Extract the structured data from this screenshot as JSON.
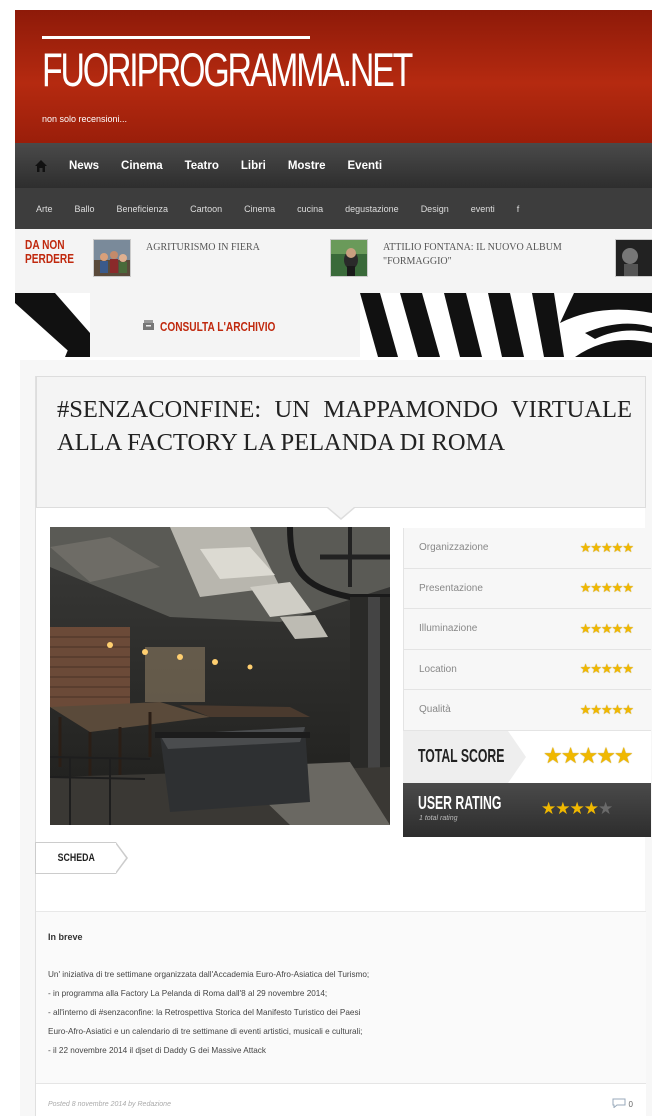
{
  "site": {
    "logo": "FUORIPROGRAMMA.NET",
    "tagline": "non solo recensioni..."
  },
  "main_nav": [
    "News",
    "Cinema",
    "Teatro",
    "Libri",
    "Mostre",
    "Eventi"
  ],
  "category_nav": [
    "Arte",
    "Ballo",
    "Beneficienza",
    "Cartoon",
    "Cinema",
    "cucina",
    "degustazione",
    "Design",
    "eventi",
    "f"
  ],
  "da_non_perdere": {
    "label": "DA NON PERDERE",
    "items": [
      {
        "title": "AGRITURISMO IN FIERA"
      },
      {
        "title": "ATTILIO FONTANA: IL NUOVO ALBUM \"FORMAGGIO\""
      }
    ]
  },
  "archive": {
    "label": "CONSULTA L'ARCHIVIO"
  },
  "article": {
    "title": "#SENZACONFINE: UN MAPPAMONDO VIRTUALE ALLA FACTORY LA PELANDA DI ROMA",
    "review": {
      "criteria": [
        {
          "name": "Organizzazione",
          "stars": 5
        },
        {
          "name": "Presentazione",
          "stars": 5
        },
        {
          "name": "Illuminazione",
          "stars": 5
        },
        {
          "name": "Location",
          "stars": 5
        },
        {
          "name": "Qualità",
          "stars": 5
        }
      ],
      "total_label": "TOTAL SCORE",
      "total_stars": 5,
      "user_label": "USER RATING",
      "user_sub": "1 total rating",
      "user_stars": 4,
      "star_color": "#f0b800"
    },
    "tab_label": "SCHEDA",
    "summary_heading": "In breve",
    "summary_lines": [
      "Un' iniziativa di tre settimane organizzata dall'Accademia Euro-Afro-Asiatica del Turismo;",
      "- in programma alla Factory La Pelanda di Roma dall'8 al 29 novembre 2014;",
      "- all'interno di #senzaconfine: la Retrospettiva Storica del Manifesto Turistico dei Paesi",
      "Euro-Afro-Asiatici e un calendario di tre settimane di eventi artistici, musicali e culturali;",
      "- il 22 novembre 2014 il djset di Daddy G dei Massive Attack"
    ],
    "posted": "Posted 8 novembre 2014 by Redazione",
    "comment_count": "0"
  },
  "colors": {
    "brand_red": "#b52a10",
    "accent_red": "#c0290e",
    "nav_dark": "#2e2e2e"
  }
}
